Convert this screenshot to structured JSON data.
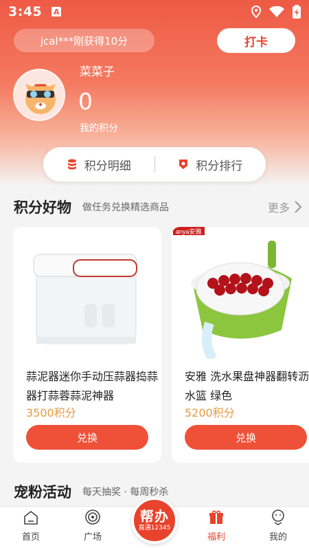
{
  "status_bar": {
    "time": "3:45",
    "app_letter": "A"
  },
  "header": {
    "notice": "jcal***刚获得10分",
    "checkin_label": "打卡",
    "username": "菜菜子",
    "points": "0",
    "points_label": "我的积分"
  },
  "tabs_pill": {
    "detail_label": "积分明细",
    "ranking_label": "积分排行"
  },
  "goods_section": {
    "title": "积分好物",
    "subtitle": "做任务兑换精选商品",
    "more_label": "更多",
    "items": [
      {
        "name": "蒜泥器迷你手动压蒜器捣蒜器打蒜蓉蒜泥神器",
        "price": "3500积分",
        "button": "兑换"
      },
      {
        "name": "安雅 洗水果盘神器翻转沥水篮 绿色",
        "price": "5200积分",
        "button": "兑换",
        "brand_tag": "anya安雅"
      }
    ]
  },
  "activity_section": {
    "title": "宠粉活动",
    "subtitle": "每天抽奖 · 每周秒杀"
  },
  "tabbar": {
    "home": "首页",
    "square": "广场",
    "center_big": "帮办",
    "center_small": "直通12345",
    "welfare": "福利",
    "mine": "我的"
  },
  "colors": {
    "accent": "#e8432d",
    "price": "#e59a3f"
  }
}
